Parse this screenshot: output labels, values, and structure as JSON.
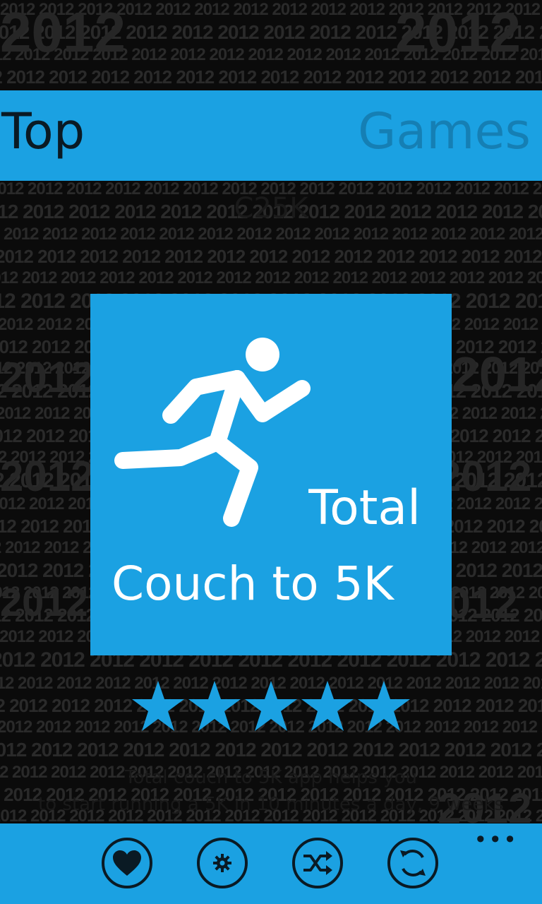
{
  "header": {
    "left_title": "Top",
    "right_title": "Games"
  },
  "app": {
    "name": "C25K",
    "tile_line1": "Total",
    "tile_line2": "Couch to 5K",
    "rating_stars": 5,
    "description_line1": "Total couch to 5K app helps you",
    "description_line2": "to start running a 5K in 10 minutes a day, 9 weeks"
  },
  "app_bar": {
    "more_label": "•••",
    "buttons": [
      {
        "icon": "heart-icon"
      },
      {
        "icon": "gear-icon"
      },
      {
        "icon": "shuffle-icon"
      },
      {
        "icon": "refresh-icon"
      }
    ]
  },
  "background": {
    "pattern_text": "2012"
  },
  "colors": {
    "accent": "#1ba1e2",
    "header_right_text": "#157fb4",
    "dark_text": "#0a1a24"
  }
}
